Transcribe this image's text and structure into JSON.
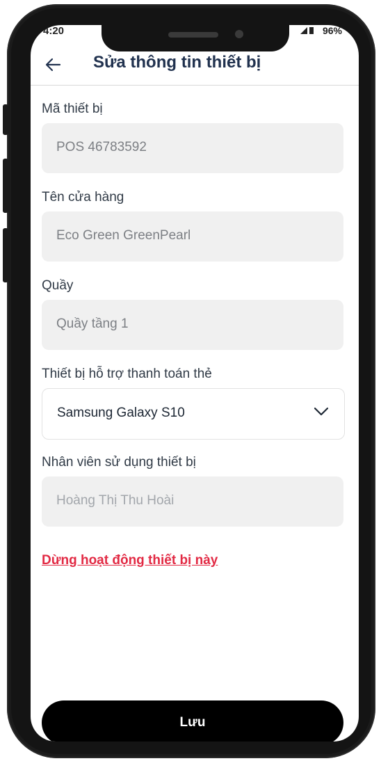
{
  "status_bar": {
    "time": "4:20",
    "battery": "96%"
  },
  "header": {
    "title": "Sửa thông tin thiết bị"
  },
  "form": {
    "device_code": {
      "label": "Mã thiết bị",
      "value": "POS 46783592"
    },
    "store_name": {
      "label": "Tên cửa hàng",
      "value": "Eco Green GreenPearl"
    },
    "counter": {
      "label": "Quầy",
      "value": "Quầy tầng 1"
    },
    "card_device": {
      "label": "Thiết bị hỗ trợ thanh toán thẻ",
      "value": "Samsung Galaxy S10"
    },
    "employee": {
      "label": "Nhân viên sử dụng thiết bị",
      "placeholder": "Hoàng Thị Thu Hoài"
    }
  },
  "stop_link": "Dừng hoạt động thiết bị này",
  "save_button": "Lưu",
  "icons": {
    "back": "arrow-left-icon",
    "dropdown": "chevron-down-icon"
  },
  "colors": {
    "danger": "#e22a44",
    "title": "#21324f",
    "field_bg": "#f0f0f0",
    "button_bg": "#000000"
  }
}
